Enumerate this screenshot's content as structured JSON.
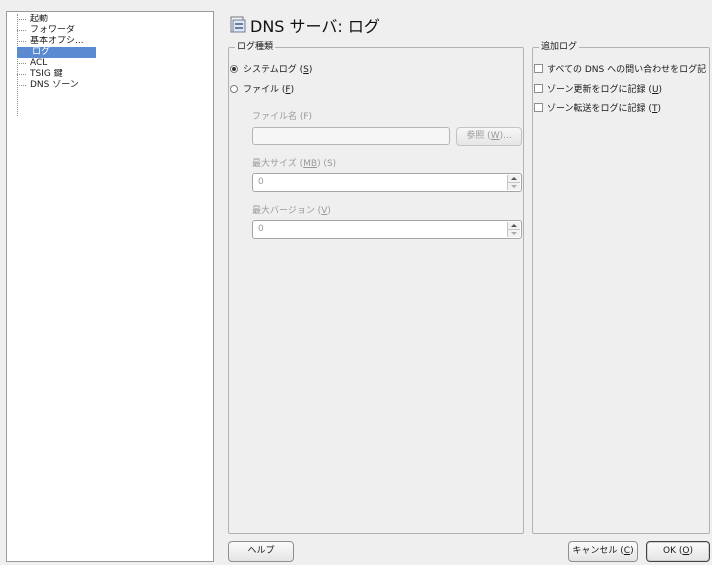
{
  "sidebar": {
    "items": [
      {
        "label": "起動",
        "selected": false
      },
      {
        "label": "フォワーダ",
        "selected": false
      },
      {
        "label": "基本オプシ...",
        "selected": false
      },
      {
        "label": "ログ",
        "selected": true
      },
      {
        "label": "ACL",
        "selected": false
      },
      {
        "label": "TSIG 鍵",
        "selected": false
      },
      {
        "label": "DNS ゾーン",
        "selected": false
      }
    ]
  },
  "header": {
    "title": "DNS サーバ: ログ",
    "icon": "server-document-icon"
  },
  "log_type": {
    "legend": "ログ種類",
    "syslog_text": "システムログ (",
    "syslog_key": "S",
    "file_text": "ファイル (",
    "file_key": "F",
    "selected": "system-log",
    "filename_label": "ファイル名 (F)",
    "filename_value": "",
    "browse_text": "参照 (",
    "browse_key": "W",
    "browse_suffix": ")...",
    "max_size_pre": "最大サイズ (",
    "max_size_key": "MB",
    "max_size_post": ") (S)",
    "max_size_value": "0",
    "max_versions_pre": "最大バージョン (",
    "max_versions_key": "V",
    "max_versions_value": "0"
  },
  "additional": {
    "legend": "追加ログ",
    "options": [
      {
        "text": "すべての DNS への問い合わせをログ記",
        "key": "",
        "checked": false
      },
      {
        "text": "ゾーン更新をログに記録 (",
        "key": "U",
        "checked": false
      },
      {
        "text": "ゾーン転送をログに記録 (",
        "key": "T",
        "checked": false
      }
    ]
  },
  "footer": {
    "help_label": "ヘルプ",
    "cancel_text": "キャンセル (",
    "cancel_key": "C",
    "ok_text": "OK (",
    "ok_key": "O"
  },
  "colors": {
    "selection": "#5a8ad2",
    "background": "#efefef"
  }
}
